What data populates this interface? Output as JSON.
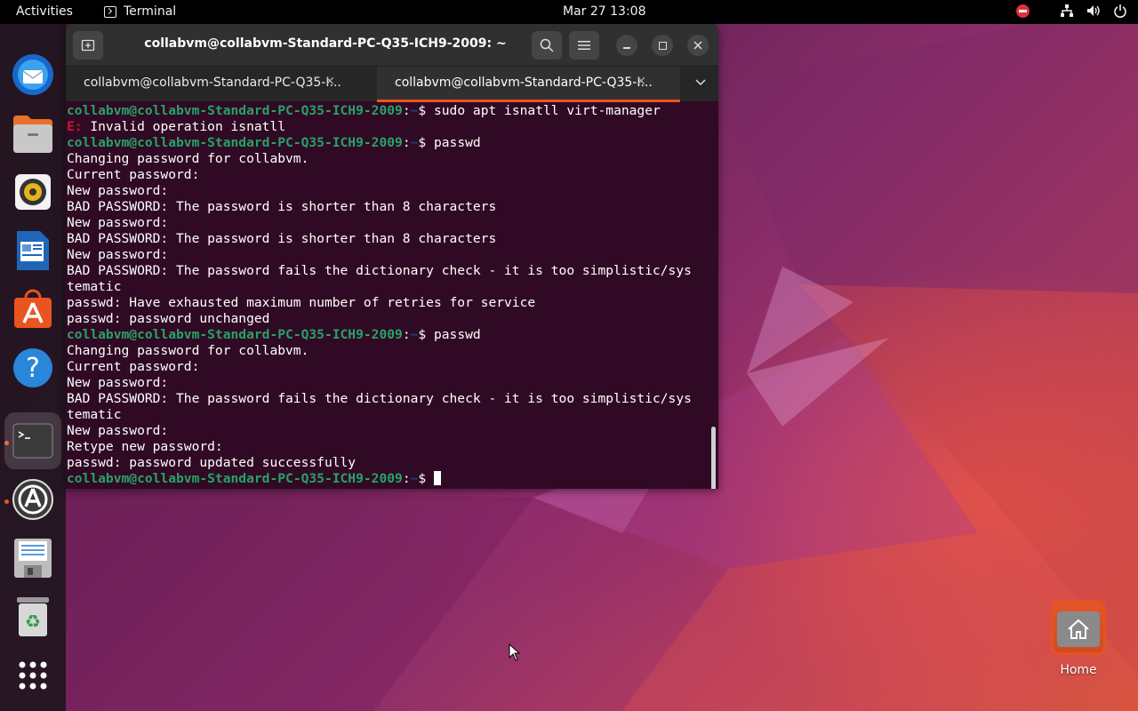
{
  "topbar": {
    "activities": "Activities",
    "app_name": "Terminal",
    "clock": "Mar 27  13:08"
  },
  "dock": {
    "items": [
      {
        "name": "thunderbird",
        "icon": "thunderbird-mail-icon"
      },
      {
        "name": "files",
        "icon": "files-folder-icon"
      },
      {
        "name": "rhythmbox",
        "icon": "rhythmbox-speaker-icon"
      },
      {
        "name": "writer",
        "icon": "libreoffice-writer-icon"
      },
      {
        "name": "app-center",
        "icon": "ubuntu-software-icon"
      },
      {
        "name": "help",
        "icon": "help-icon"
      },
      {
        "name": "terminal",
        "icon": "terminal-icon"
      },
      {
        "name": "software-updater",
        "icon": "software-updater-icon"
      },
      {
        "name": "save",
        "icon": "floppy-disk-icon"
      },
      {
        "name": "trash",
        "icon": "trash-icon"
      },
      {
        "name": "show-apps",
        "icon": "app-grid-icon"
      }
    ]
  },
  "terminal": {
    "title": "collabvm@collabvm-Standard-PC-Q35-ICH9-2009: ~",
    "tabs": [
      {
        "label": "collabvm@collabvm-Standard-PC-Q35-I...",
        "active": false
      },
      {
        "label": "collabvm@collabvm-Standard-PC-Q35-I...",
        "active": true
      }
    ],
    "prompt_user": "collabvm@collabvm-Standard-PC-Q35-ICH9-2009",
    "prompt_path": "~",
    "lines": [
      {
        "type": "cmd",
        "text": "sudo apt isnatll virt-manager"
      },
      {
        "type": "err",
        "prefix": "E:",
        "text": " Invalid operation isnatll"
      },
      {
        "type": "cmd",
        "text": "passwd"
      },
      {
        "type": "out",
        "text": "Changing password for collabvm."
      },
      {
        "type": "out",
        "text": "Current password:"
      },
      {
        "type": "out",
        "text": "New password:"
      },
      {
        "type": "out",
        "text": "BAD PASSWORD: The password is shorter than 8 characters"
      },
      {
        "type": "out",
        "text": "New password:"
      },
      {
        "type": "out",
        "text": "BAD PASSWORD: The password is shorter than 8 characters"
      },
      {
        "type": "out",
        "text": "New password:"
      },
      {
        "type": "out",
        "text": "BAD PASSWORD: The password fails the dictionary check - it is too simplistic/sys"
      },
      {
        "type": "out",
        "text": "tematic"
      },
      {
        "type": "out",
        "text": "passwd: Have exhausted maximum number of retries for service"
      },
      {
        "type": "out",
        "text": "passwd: password unchanged"
      },
      {
        "type": "cmd",
        "text": "passwd"
      },
      {
        "type": "out",
        "text": "Changing password for collabvm."
      },
      {
        "type": "out",
        "text": "Current password:"
      },
      {
        "type": "out",
        "text": "New password:"
      },
      {
        "type": "out",
        "text": "BAD PASSWORD: The password fails the dictionary check - it is too simplistic/sys"
      },
      {
        "type": "out",
        "text": "tematic"
      },
      {
        "type": "out",
        "text": "New password:"
      },
      {
        "type": "out",
        "text": "Retype new password:"
      },
      {
        "type": "out",
        "text": "passwd: password updated successfully"
      },
      {
        "type": "prompt",
        "text": ""
      }
    ]
  },
  "desktop": {
    "home_label": "Home"
  },
  "colors": {
    "ubuntu_orange": "#e95420",
    "terminal_bg": "#300a24",
    "prompt_green": "#26a269",
    "prompt_blue": "#12488b",
    "error_red": "#c01c28"
  }
}
